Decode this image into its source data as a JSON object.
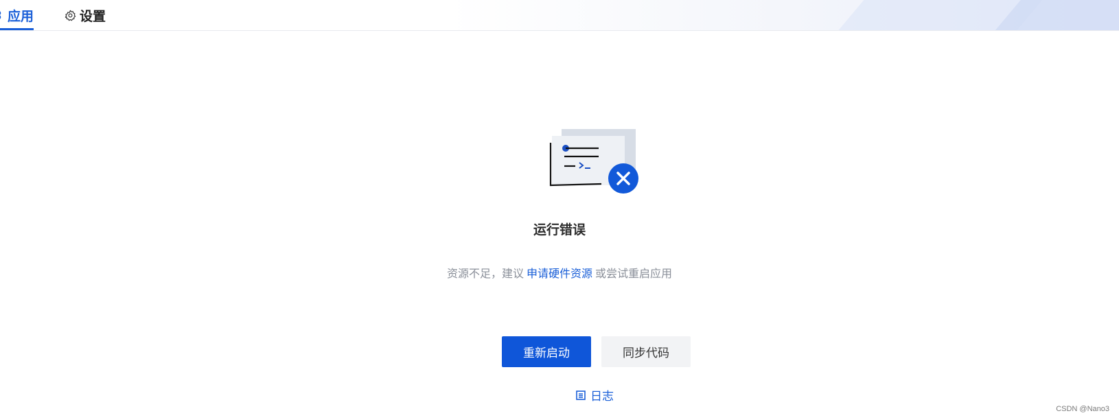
{
  "tabs": [
    {
      "label": "应用",
      "icon": "apps-icon",
      "active": true
    },
    {
      "label": "设置",
      "icon": "gear-icon",
      "active": false
    }
  ],
  "error": {
    "illustration": "terminal-error-illustration",
    "title": "运行错误",
    "desc_prefix": "资源不足，建议",
    "desc_link": "申请硬件资源",
    "desc_suffix": "或尝试重启应用"
  },
  "actions": {
    "restart_label": "重新启动",
    "sync_label": "同步代码",
    "log_label": "日志",
    "log_icon": "log-list-icon"
  },
  "watermark": "CSDN @Nano3",
  "colors": {
    "accent": "#1a5fd8",
    "primary_button": "#0f56d9",
    "secondary_button": "#f2f3f5",
    "muted_text": "#8a8f99"
  }
}
